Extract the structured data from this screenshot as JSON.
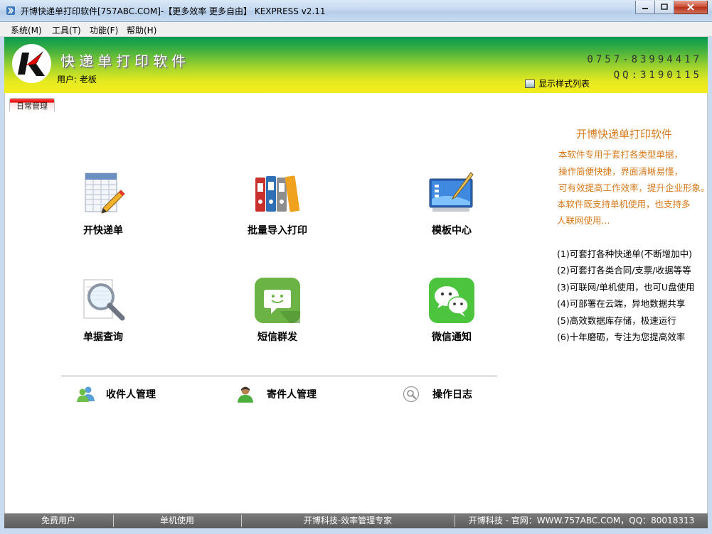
{
  "window": {
    "title": "开博快递单打印软件[757ABC.COM]-【更多效率 更多自由】 KEXPRESS v2.11"
  },
  "menu": {
    "items": [
      {
        "label": "系统(M)"
      },
      {
        "label": "工具(T)"
      },
      {
        "label": "功能(F)"
      },
      {
        "label": "帮助(H)"
      }
    ]
  },
  "banner": {
    "app_name": "快递单打印软件",
    "user_label": "用户: 老板",
    "phone": "0757-83994417",
    "qq": "QQ:3190115",
    "style_list_label": "显示样式列表"
  },
  "tabs": {
    "daily": "日常管理"
  },
  "tiles": [
    {
      "label": "开快递单",
      "icon": "spreadsheet-pencil-icon"
    },
    {
      "label": "批量导入打印",
      "icon": "binders-icon"
    },
    {
      "label": "模板中心",
      "icon": "template-board-icon"
    },
    {
      "label": "单据查询",
      "icon": "magnifier-icon"
    },
    {
      "label": "短信群发",
      "icon": "sms-icon"
    },
    {
      "label": "微信通知",
      "icon": "wechat-icon"
    }
  ],
  "management": [
    {
      "label": "收件人管理",
      "icon": "users-icon"
    },
    {
      "label": "寄件人管理",
      "icon": "user-icon"
    },
    {
      "label": "操作日志",
      "icon": "search-log-icon"
    }
  ],
  "info": {
    "title": "开博快递单打印软件",
    "lines": [
      "本软件专用于套打各类型单据，",
      "操作简便快捷，界面清晰易懂，",
      "可有效提高工作效率，提升企业形象。",
      "本软件既支持单机使用，也支持多",
      "人联网使用..."
    ],
    "features": [
      "(1)可套打各种快递单(不断增加中)",
      "(2)可套打各类合同/支票/收据等等",
      "(3)可联网/单机使用，也可U盘使用",
      "(4)可部署在云端，异地数据共享",
      "(5)高效数据库存储，极速运行",
      "(6)十年磨砺，专注为您提高效率"
    ]
  },
  "status": {
    "user_type": "免费用户",
    "mode": "单机使用",
    "slogan": "开博科技-效率管理专家",
    "contact": "开博科技 - 官网：WWW.757ABC.COM，QQ：80018313"
  },
  "colors": {
    "accent_orange": "#d8781a",
    "banner_green": "#079a52",
    "banner_yellow": "#f4ed1c",
    "status_gray": "#6a6a6a"
  }
}
